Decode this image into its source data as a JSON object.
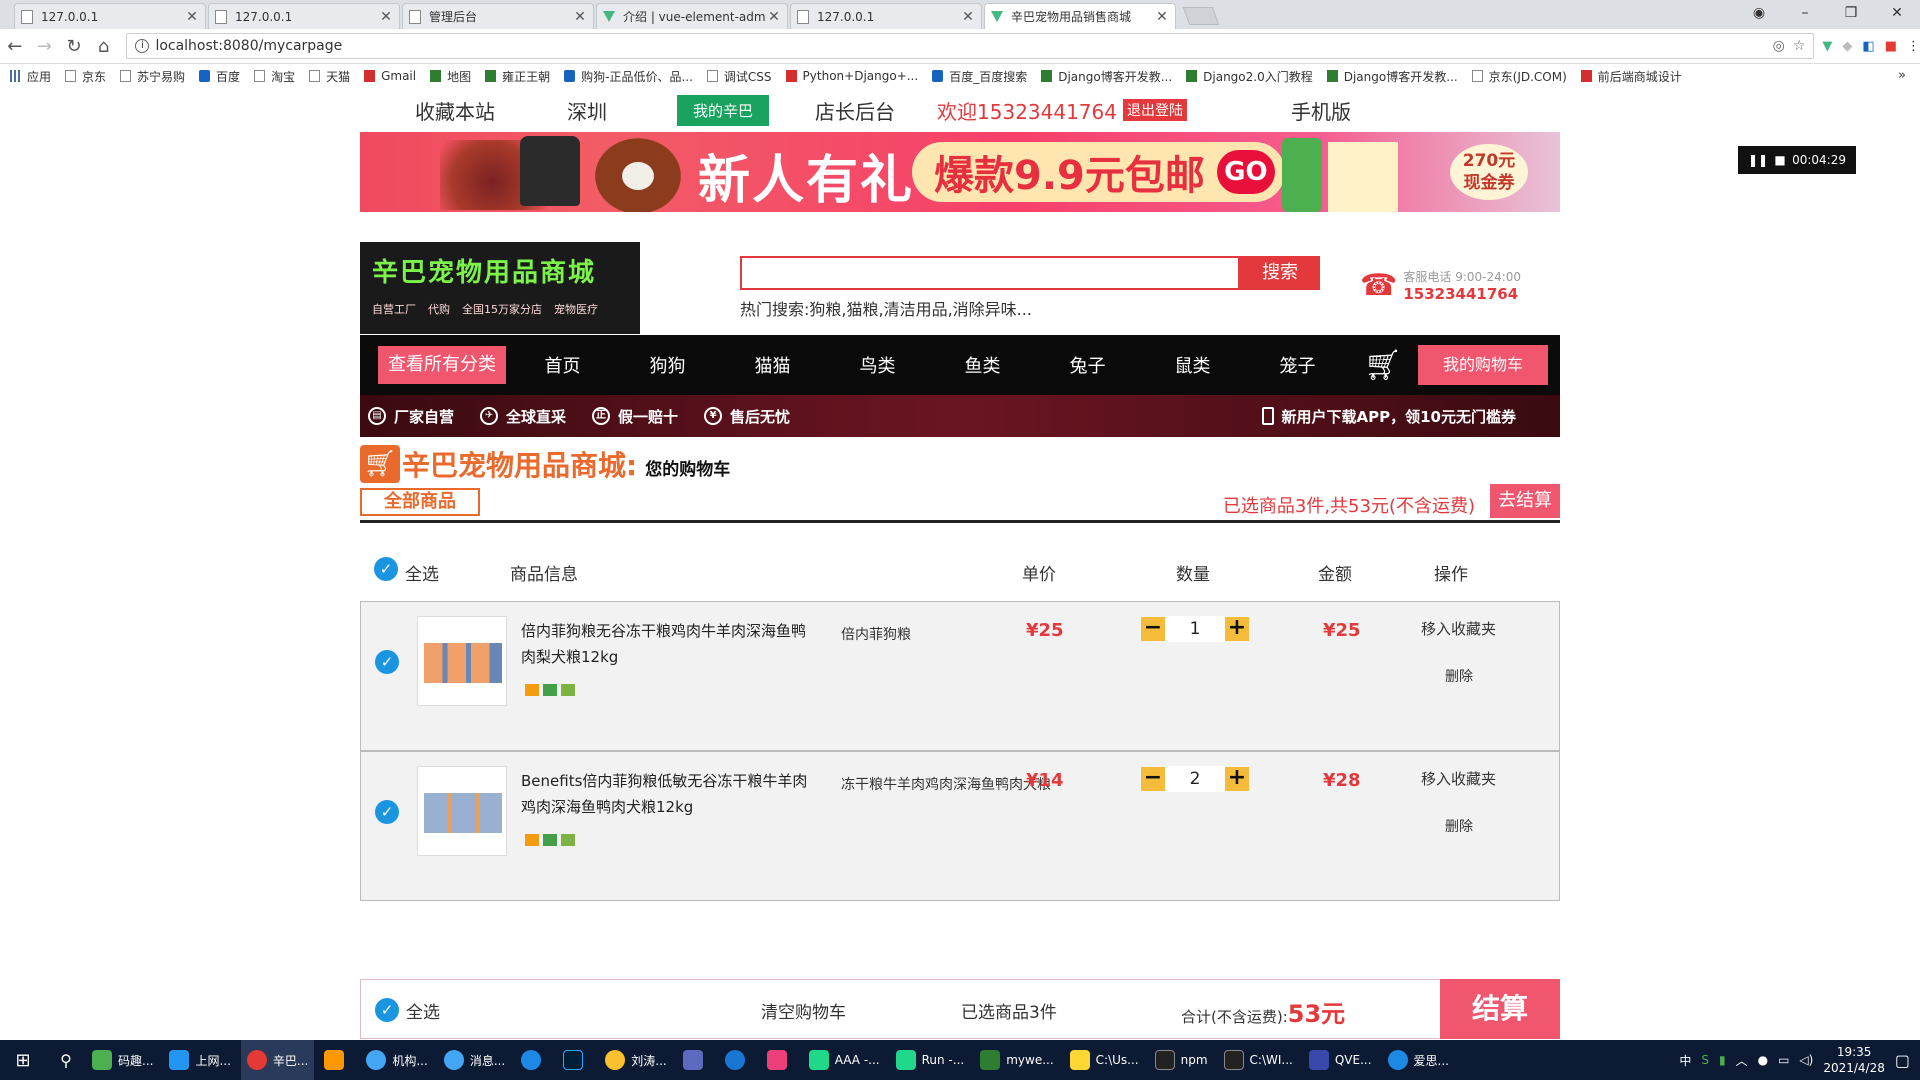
{
  "browser": {
    "tabs": [
      {
        "title": "127.0.0.1",
        "active": false,
        "icon": "page-icon"
      },
      {
        "title": "127.0.0.1",
        "active": false,
        "icon": "page-icon"
      },
      {
        "title": "管理后台",
        "active": false,
        "icon": "page-icon"
      },
      {
        "title": "介绍 | vue-element-adm",
        "active": false,
        "icon": "vue-icon"
      },
      {
        "title": "127.0.0.1",
        "active": false,
        "icon": "page-icon"
      },
      {
        "title": "辛巴宠物用品销售商城",
        "active": true,
        "icon": "vue-icon"
      }
    ],
    "url": "localhost:8080/mycarpage",
    "bookmarks": [
      "应用",
      "京东",
      "苏宁易购",
      "百度",
      "淘宝",
      "天猫",
      "Gmail",
      "地图",
      "雍正王朝",
      "购狗-正品低价、品...",
      "调试CSS",
      "Python+Django+...",
      "百度_百度搜索",
      "Django博客开发教...",
      "Django2.0入门教程",
      "Django博客开发教...",
      "京东(JD.COM)",
      "前后端商城设计"
    ]
  },
  "topnav": {
    "favorite": "收藏本站",
    "city": "深圳",
    "mine": "我的辛巴",
    "shop_admin": "店长后台",
    "welcome": "欢迎15323441764",
    "logout": "退出登陆",
    "mobile": "手机版"
  },
  "banner": {
    "title": "新人有礼",
    "deal": "爆款9.9元包邮",
    "go": "GO",
    "coupon_amount": "270元",
    "coupon_label": "现金券"
  },
  "timer": "00:04:29",
  "logo": {
    "title": "辛巴宠物用品商城",
    "tags": [
      "自营工厂",
      "代购",
      "全国15万家分店",
      "宠物医疗"
    ]
  },
  "search": {
    "placeholder": "",
    "button": "搜索",
    "hot": "热门搜索:狗粮,猫粮,清洁用品,消除异味..."
  },
  "hotline": {
    "label": "客服电话 9:00-24:00",
    "number": "15323441764"
  },
  "categories": {
    "all": "查看所有分类",
    "items": [
      "首页",
      "狗狗",
      "猫猫",
      "鸟类",
      "鱼类",
      "兔子",
      "鼠类",
      "笼子"
    ],
    "my_cart": "我的购物车"
  },
  "promo": {
    "items": [
      "厂家自营",
      "全球直采",
      "假一赔十",
      "售后无忧"
    ],
    "app": "新用户下载APP，领10元无门槛券"
  },
  "cart": {
    "shop_name": "辛巴宠物用品商城:",
    "subtitle": "您的购物车",
    "all_goods": "全部商品",
    "selected_summary": "已选商品3件,共53元(不含运费)",
    "go_settle": "去结算",
    "columns": {
      "select_all": "全选",
      "info": "商品信息",
      "unit_price": "单价",
      "quantity": "数量",
      "amount": "金额",
      "action": "操作"
    },
    "items": [
      {
        "name": "倍内菲狗粮无谷冻干粮鸡肉牛羊肉深海鱼鸭肉梨犬粮12kg",
        "spec": "倍内菲狗粮",
        "price": "¥25",
        "quantity": "1",
        "total": "¥25",
        "fav": "移入收藏夹",
        "delete": "删除"
      },
      {
        "name": "Benefits倍内菲狗粮低敏无谷冻干粮牛羊肉鸡肉深海鱼鸭肉犬粮12kg",
        "spec": "冻干粮牛羊肉鸡肉深海鱼鸭肉犬粮",
        "price": "¥14",
        "quantity": "2",
        "total": "¥28",
        "fav": "移入收藏夹",
        "delete": "删除"
      }
    ],
    "footer": {
      "select_all": "全选",
      "clear": "清空购物车",
      "selected": "已选商品3件",
      "total_label": "合计(不含运费):",
      "total_value": "53元",
      "settle": "结算"
    }
  },
  "taskbar": {
    "apps": [
      "码趣...",
      "上网...",
      "辛巴...",
      "",
      "机构...",
      "消息...",
      "",
      "",
      "刘涛...",
      "",
      "",
      "",
      "AAA -...",
      "Run -...",
      "mywe...",
      "C:\\Us...",
      "npm",
      "C:\\WI...",
      "QVE...",
      "爱思..."
    ],
    "time": "19:35",
    "date": "2021/4/28"
  },
  "colors": {
    "brand_red": "#e4393c",
    "pink": "#f0566e",
    "orange": "#ea6a2e",
    "check_blue": "#1a95e0"
  }
}
